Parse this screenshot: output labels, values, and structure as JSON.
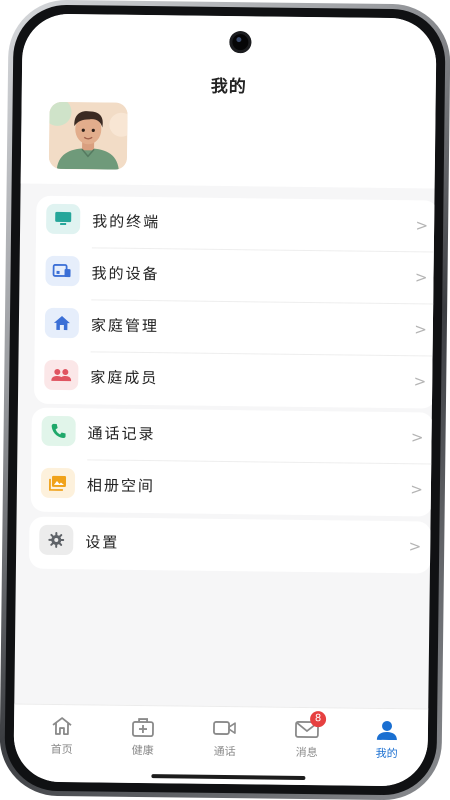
{
  "header": {
    "title": "我的"
  },
  "profile": {
    "avatar_name": "user-avatar"
  },
  "menu_groups": [
    {
      "items": [
        {
          "label": "我的终端",
          "icon": "monitor-icon",
          "color": "#26a69a",
          "bg": "#e0f3f1"
        },
        {
          "label": "我的设备",
          "icon": "devices-icon",
          "color": "#3b6fd6",
          "bg": "#e6eefb"
        },
        {
          "label": "家庭管理",
          "icon": "home-icon",
          "color": "#3b6fd6",
          "bg": "#e6eefb"
        },
        {
          "label": "家庭成员",
          "icon": "group-icon",
          "color": "#e05561",
          "bg": "#fbe7e8"
        }
      ]
    },
    {
      "items": [
        {
          "label": "通话记录",
          "icon": "phone-icon",
          "color": "#1fa86a",
          "bg": "#e1f5ea"
        },
        {
          "label": "相册空间",
          "icon": "photo-album-icon",
          "color": "#f0a21a",
          "bg": "#fdf1dc"
        }
      ]
    },
    {
      "items": [
        {
          "label": "设置",
          "icon": "gear-icon",
          "color": "#5f6368",
          "bg": "#ececec"
        }
      ]
    }
  ],
  "chevron": ">",
  "tabbar": {
    "tabs": [
      {
        "label": "首页",
        "icon": "home-outline-icon"
      },
      {
        "label": "健康",
        "icon": "medical-kit-icon"
      },
      {
        "label": "通话",
        "icon": "video-call-icon"
      },
      {
        "label": "消息",
        "icon": "mail-icon",
        "badge": "8"
      },
      {
        "label": "我的",
        "icon": "person-icon",
        "active": true
      }
    ],
    "active_color": "#1a6fd1",
    "inactive_color": "#8a8a8a"
  }
}
